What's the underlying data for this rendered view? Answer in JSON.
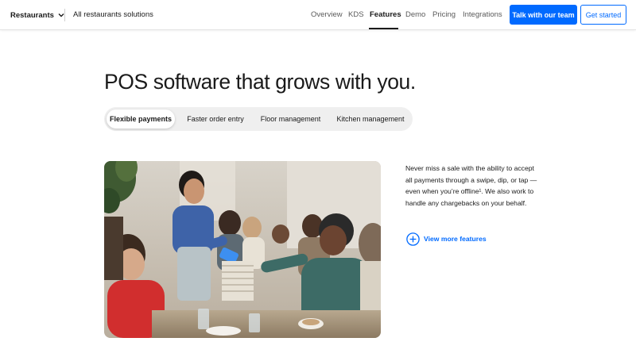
{
  "nav": {
    "brand_menu": "Restaurants",
    "solutions_link": "All restaurants solutions",
    "links": [
      {
        "label": "Overview",
        "active": false
      },
      {
        "label": "KDS",
        "active": false
      },
      {
        "label": "Features",
        "active": true
      },
      {
        "label": "Demo",
        "active": false
      },
      {
        "label": "Pricing",
        "active": false
      },
      {
        "label": "Integrations",
        "active": false
      }
    ],
    "cta_primary": "Talk with our team",
    "cta_secondary": "Get started"
  },
  "hero": {
    "headline": "POS software that grows with you."
  },
  "tabs": [
    {
      "label": "Flexible payments",
      "selected": true
    },
    {
      "label": "Faster order entry",
      "selected": false
    },
    {
      "label": "Floor management",
      "selected": false
    },
    {
      "label": "Kitchen management",
      "selected": false
    }
  ],
  "feature": {
    "description": "Never miss a sale with the ability to accept all payments through a swipe, dip, or tap — even when you’re offline¹. We also work to handle any chargebacks on your behalf.",
    "more_link": "View more features"
  },
  "colors": {
    "accent": "#006aff",
    "text": "#1a1a1a",
    "tab_background": "#efefef"
  },
  "icons": {
    "brand_menu": "chevron-down-icon",
    "more_link": "plus-circle-icon"
  }
}
